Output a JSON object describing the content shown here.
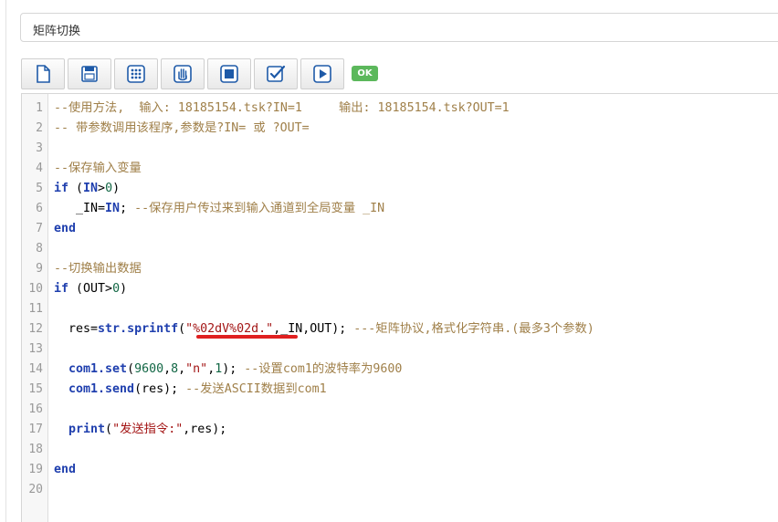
{
  "title": "矩阵切换",
  "toolbar": {
    "buttons": [
      {
        "name": "new-file-icon"
      },
      {
        "name": "save-icon"
      },
      {
        "name": "keypad-icon"
      },
      {
        "name": "hand-icon"
      },
      {
        "name": "stop-icon"
      },
      {
        "name": "check-icon"
      },
      {
        "name": "play-icon"
      }
    ],
    "status_badge": "OK"
  },
  "editor": {
    "line_numbers": [
      "1",
      "2",
      "3",
      "4",
      "5",
      "6",
      "7",
      "8",
      "9",
      "10",
      "11",
      "12",
      "13",
      "14",
      "15",
      "16",
      "17",
      "18",
      "19",
      "20"
    ],
    "code": {
      "l1": "--使用方法,  输入: 18185154.tsk?IN=1     输出: 18185154.tsk?OUT=1",
      "l2": "-- 带参数调用该程序,参数是?IN= 或 ?OUT=",
      "l4": "--保存输入变量",
      "l5_kw": "if",
      "l5_open": " (",
      "l5_var": "IN",
      "l5_op": ">",
      "l5_num": "0",
      "l5_close": ")",
      "l6_indent": "   _IN=",
      "l6_var": "IN",
      "l6_semi": "; ",
      "l6_comment": "--保存用户传过来到输入通道到全局变量 _IN",
      "l7": "end",
      "l9": "--切换输出数据",
      "l10_kw": "if",
      "l10_rest": " (OUT>",
      "l10_num": "0",
      "l10_close": ")",
      "l12_a": "  res=",
      "l12_fn": "str.sprintf",
      "l12_b": "(",
      "l12_str": "\"%02dV%02d.\"",
      "l12_c": ",_IN,OUT); ",
      "l12_comment": "---矩阵协议,格式化字符串.(最多3个参数)",
      "l14_a": "  ",
      "l14_fn": "com1.set",
      "l14_b": "(",
      "l14_n1": "9600",
      "l14_c": ",",
      "l14_n2": "8",
      "l14_d": ",",
      "l14_s": "\"n\"",
      "l14_e": ",",
      "l14_n3": "1",
      "l14_f": "); ",
      "l14_comment": "--设置com1的波特率为9600",
      "l15_a": "  ",
      "l15_fn": "com1.send",
      "l15_b": "(res); ",
      "l15_comment": "--发送ASCII数据到com1",
      "l17_a": "  ",
      "l17_fn": "print",
      "l17_b": "(",
      "l17_str": "\"发送指令:\"",
      "l17_c": ",res);",
      "l19": "end"
    }
  },
  "colors": {
    "comment": "#a0804a",
    "keyword": "#1f3fae",
    "number": "#116644",
    "string": "#a31515",
    "ok_badge": "#5cb85c",
    "annotation_underline": "#e02020"
  }
}
